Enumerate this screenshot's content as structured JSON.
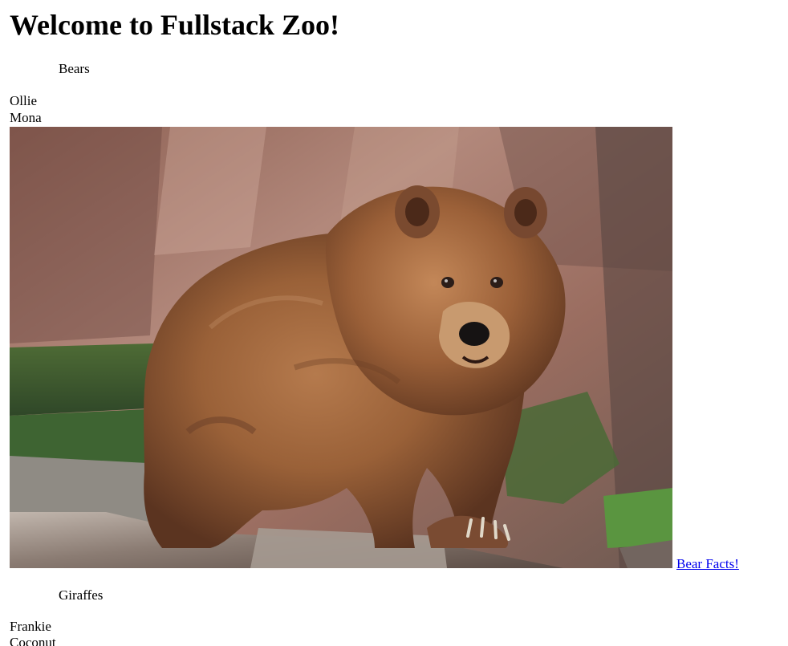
{
  "page": {
    "title": "Welcome to Fullstack Zoo!"
  },
  "bears": {
    "section_title": "Bears",
    "animals": [
      "Ollie",
      "Mona"
    ],
    "image_name": "brown-bear-photo",
    "facts_link_label": "Bear Facts!"
  },
  "giraffes": {
    "section_title": "Giraffes",
    "animals": [
      "Frankie",
      "Coconut"
    ]
  },
  "colors": {
    "link": "#0000ee",
    "text": "#000000",
    "background": "#ffffff"
  }
}
